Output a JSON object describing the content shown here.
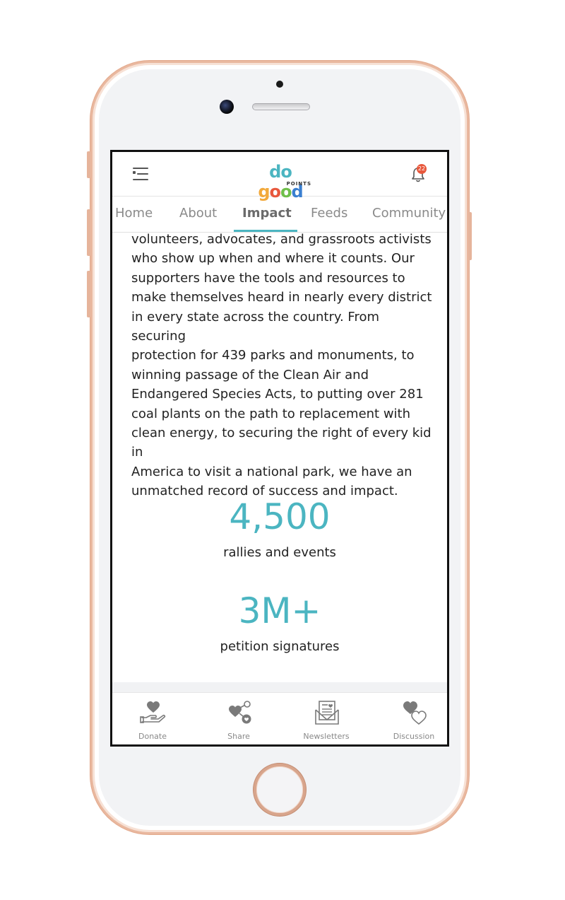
{
  "header": {
    "logo_line1": "do good",
    "logo_line2": "POINTS",
    "notification_count": "22"
  },
  "tabs": [
    {
      "label": "Home"
    },
    {
      "label": "About"
    },
    {
      "label": "Impact",
      "active": true
    },
    {
      "label": "Feeds"
    },
    {
      "label": "Community"
    }
  ],
  "content": {
    "paragraph": "volunteers, advocates, and grassroots activists\nwho show up when and where it counts. Our\nsupporters have the tools and resources to\nmake themselves heard in nearly every district\nin every state across the country. From securing\nprotection for 439 parks and monuments, to\nwinning passage of the Clean Air and\nEndangered Species Acts, to putting over 281\ncoal plants on the path to replacement with\nclean energy, to securing the right of every kid in\nAmerica to visit a national park, we have an\nunmatched record of success and impact.",
    "stats": [
      {
        "value": "4,500",
        "label": "rallies and events"
      },
      {
        "value": "3M+",
        "label": "petition signatures"
      }
    ]
  },
  "bottom_nav": [
    {
      "label": "Donate",
      "icon": "donate-hand-heart-icon"
    },
    {
      "label": "Share",
      "icon": "share-heart-icon"
    },
    {
      "label": "Newsletters",
      "icon": "newsletter-envelope-icon"
    },
    {
      "label": "Discussion",
      "icon": "discussion-hearts-icon"
    }
  ],
  "colors": {
    "accent": "#4bb5c1",
    "badge": "#e8583d",
    "phone_frame": "#e9b89f",
    "logo_do": "#4bb5c1",
    "logo_g": "#f2a93b",
    "logo_o1": "#e8583d",
    "logo_o2": "#6fbf4a",
    "logo_d": "#3a7fd0"
  }
}
